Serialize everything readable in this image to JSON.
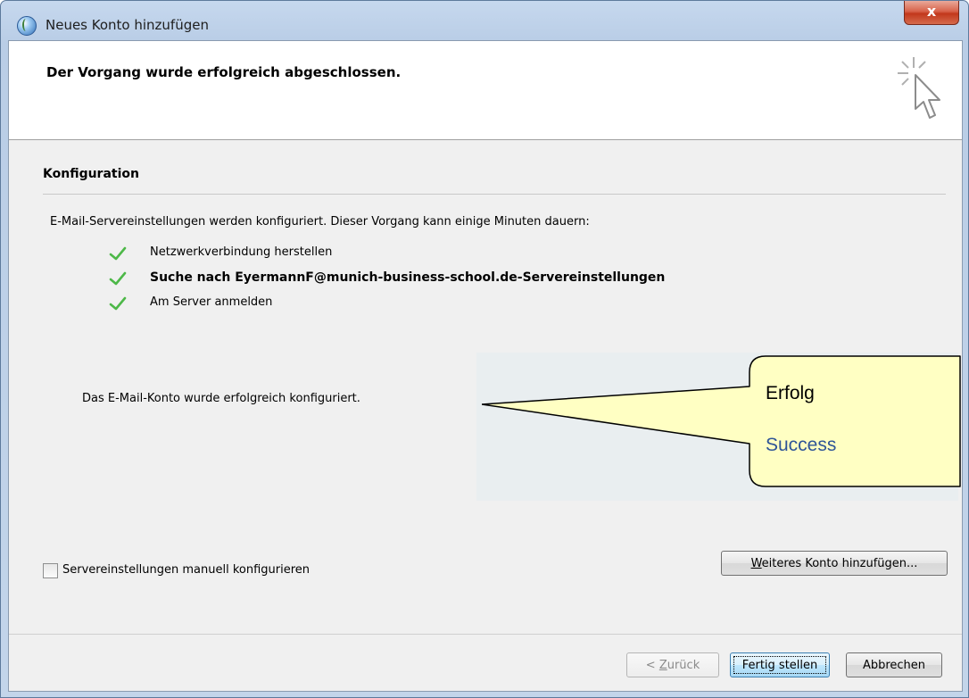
{
  "window": {
    "title": "Neues Konto hinzufügen",
    "close_label": "x"
  },
  "header": {
    "title": "Der Vorgang wurde erfolgreich abgeschlossen."
  },
  "config": {
    "section_title": "Konfiguration",
    "intro": "E-Mail-Servereinstellungen werden konfiguriert. Dieser Vorgang kann einige Minuten dauern:",
    "steps": [
      {
        "label": "Netzwerkverbindung herstellen",
        "status": "done"
      },
      {
        "label": "Suche nach EyermannF@munich-business-school.de-Servereinstellungen",
        "status": "done"
      },
      {
        "label": "Am Server anmelden",
        "status": "done"
      }
    ],
    "result": "Das E-Mail-Konto wurde erfolgreich konfiguriert."
  },
  "callout": {
    "line1": "Erfolg",
    "line2": "Success",
    "fill": "#ffffc3",
    "line2_color": "#2f5597"
  },
  "manual_checkbox": {
    "label": "Servereinstellungen manuell konfigurieren",
    "checked": false
  },
  "buttons": {
    "more_accel": "W",
    "more_rest": "eiteres Konto hinzufügen...",
    "back_prefix": "< ",
    "back_accel": "Z",
    "back_rest": "urück",
    "finish": "Fertig stellen",
    "cancel": "Abbrechen"
  },
  "colors": {
    "check": "#4db848",
    "title_bar": "#c3d5ea",
    "close_button": "#c2381c"
  }
}
